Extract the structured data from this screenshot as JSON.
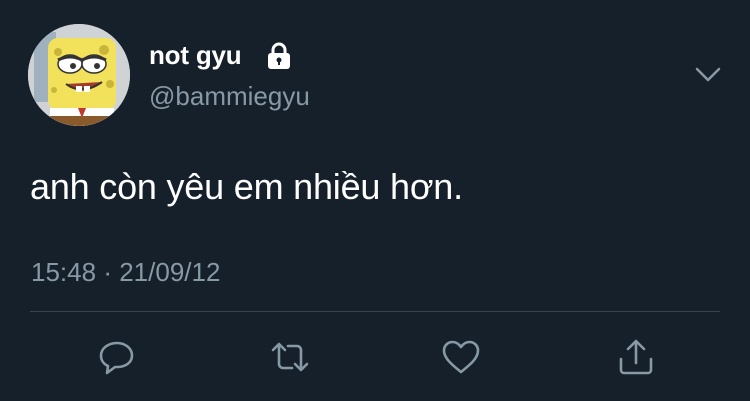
{
  "tweet": {
    "display_name": "not gyu",
    "handle": "@bammiegyu",
    "text": "anh còn yêu em nhiều hơn.",
    "time": "15:48",
    "separator": "·",
    "date": "21/09/12",
    "protected": true
  },
  "icons": {
    "lock": "lock-icon",
    "more": "chevron-down-icon",
    "reply": "reply-icon",
    "retweet": "retweet-icon",
    "like": "heart-icon",
    "share": "share-icon"
  },
  "colors": {
    "background": "#15202b",
    "text_primary": "#ffffff",
    "text_secondary": "#8899a6",
    "divider": "#38444d"
  }
}
